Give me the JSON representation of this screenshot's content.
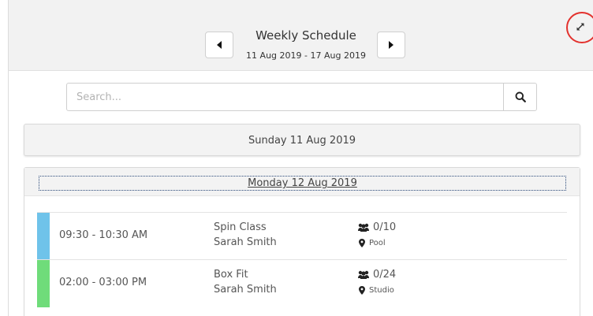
{
  "header": {
    "title": "Weekly Schedule",
    "date_range": "11 Aug 2019 - 17 Aug 2019",
    "prev_icon": "caret-left-icon",
    "next_icon": "caret-right-icon",
    "expand_icon": "expand-icon"
  },
  "search": {
    "placeholder": "Search...",
    "value": "",
    "icon": "search-icon"
  },
  "days": [
    {
      "label": "Sunday 11 Aug 2019"
    },
    {
      "label": "Monday 12 Aug 2019"
    }
  ],
  "sessions": [
    {
      "time": "09:30 - 10:30 AM",
      "title": "Spin Class",
      "instructor": "Sarah Smith",
      "capacity": "0/10",
      "location": "Pool",
      "color": "#6fc3ea"
    },
    {
      "time": "02:00 - 03:00 PM",
      "title": "Box Fit",
      "instructor": "Sarah Smith",
      "capacity": "0/24",
      "location": "Studio",
      "color": "#6fdc7a"
    }
  ],
  "colors": {
    "header_bg": "#f2f2f2",
    "highlight_ring": "#e3312d"
  }
}
